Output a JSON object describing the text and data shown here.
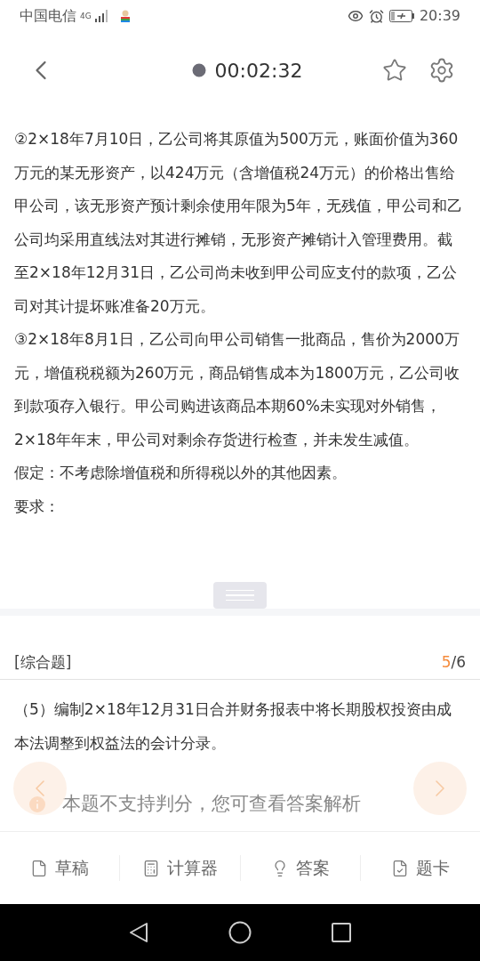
{
  "status_bar": {
    "carrier": "中国电信",
    "network": "4G",
    "time": "20:39"
  },
  "header": {
    "timer": "00:02:32",
    "favorite": false
  },
  "passage": [
    "②2×18年7月10日，乙公司将其原值为500万元，账面价值为360万元的某无形资产，以424万元（含增值税24万元）的价格出售给甲公司，该无形资产预计剩余使用年限为5年，无残值，甲公司和乙公司均采用直线法对其进行摊销，无形资产摊销计入管理费用。截至2×18年12月31日，乙公司尚未收到甲公司应支付的款项，乙公司对其计提坏账准备20万元。",
    "③2×18年8月1日，乙公司向甲公司销售一批商品，售价为2000万元，增值税税额为260万元，商品销售成本为1800万元，乙公司收到款项存入银行。甲公司购进该商品本期60%未实现对外销售，2×18年年末，甲公司对剩余存货进行检查，并未发生减值。",
    "假定：不考虑除增值税和所得税以外的其他因素。",
    "要求："
  ],
  "question": {
    "type": "[综合题]",
    "current": "5",
    "total": "/6",
    "text": "（5）编制2×18年12月31日合并财务报表中将长期股权投资由成本法调整到权益法的会计分录。",
    "notice": "本题不支持判分，您可查看答案解析"
  },
  "toolbar": [
    {
      "label": "草稿"
    },
    {
      "label": "计算器"
    },
    {
      "label": "答案"
    },
    {
      "label": "题卡"
    }
  ]
}
